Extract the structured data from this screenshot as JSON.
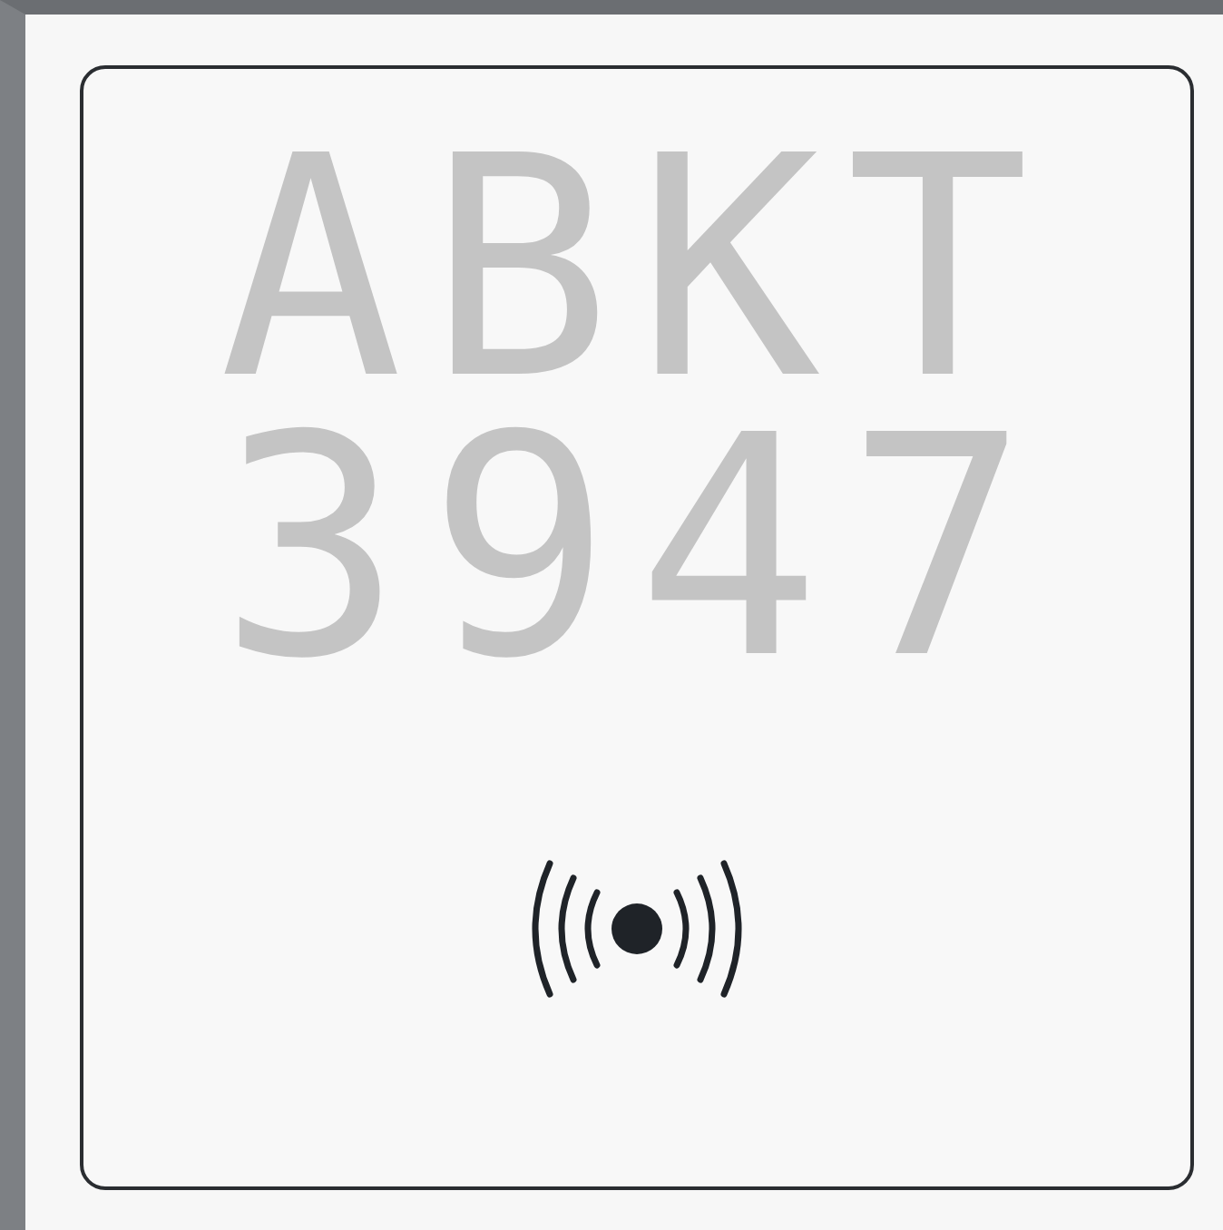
{
  "display": {
    "lines": [
      "ABKT",
      "3947"
    ]
  }
}
